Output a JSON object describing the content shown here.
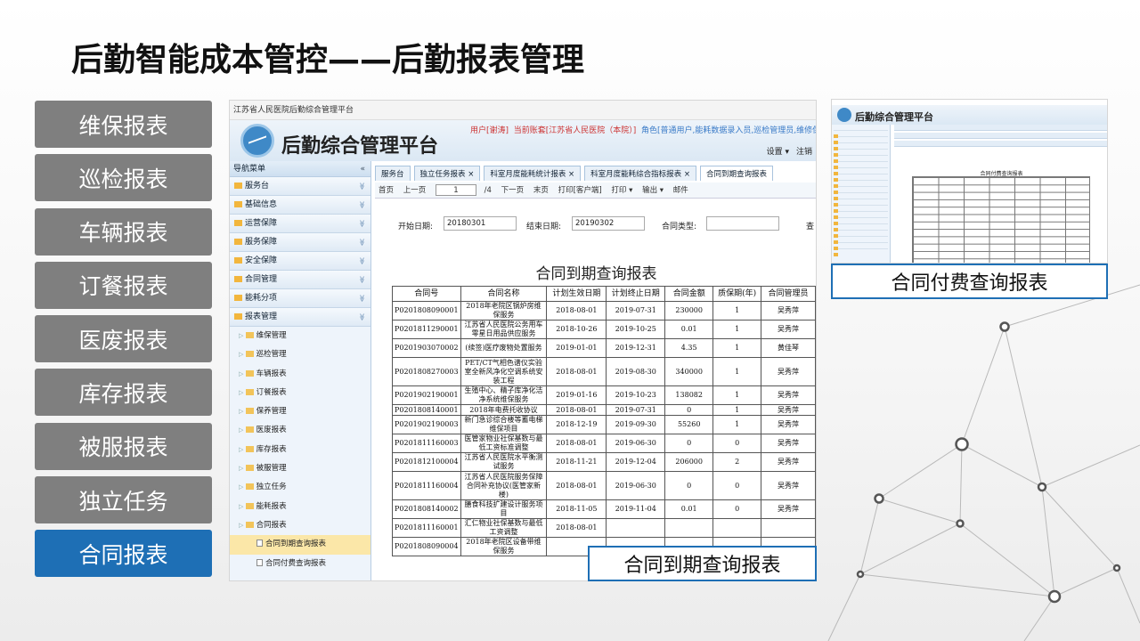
{
  "slide": {
    "title": "后勤智能成本管控——后勤报表管理",
    "menu": [
      "维保报表",
      "巡检报表",
      "车辆报表",
      "订餐报表",
      "医废报表",
      "库存报表",
      "被服报表",
      "独立任务",
      "合同报表"
    ],
    "active_index": 8,
    "caption_main": "合同到期查询报表",
    "caption_small": "合同付费查询报表",
    "colors": {
      "active": "#1e6fb5",
      "menu_bg": "#7f7f7f"
    }
  },
  "app": {
    "top_bar": "江苏省人民医院后勤综合管理平台",
    "app_title": "后勤综合管理平台",
    "user_line_a": "用户[谢涛]",
    "user_line_b": "当前账套[江苏省人民医院（本院）]",
    "user_line_c": "角色[普通用户,能耗数据录入员,巡检管理员,维修保障",
    "settings": "设置 ▾",
    "logout": "注销",
    "nav_header": "导航菜单",
    "nav": [
      "服务台",
      "基础信息",
      "运营保障",
      "服务保障",
      "安全保障",
      "合同管理",
      "能耗分项",
      "报表管理"
    ],
    "sub": [
      "维保管理",
      "巡检管理",
      "车辆报表",
      "订餐报表",
      "保养管理",
      "医废报表",
      "库存报表",
      "被服管理",
      "独立任务",
      "能耗报表",
      "合同报表"
    ],
    "leaf": [
      "合同到期查询报表",
      "合同付费查询报表"
    ],
    "tabs": [
      "服务台",
      "独立任务报表 ×",
      "科室月度能耗统计报表 ×",
      "科室月度能耗综合指标报表 ×",
      "合同到期查询报表"
    ],
    "toolbar": {
      "first": "首页",
      "prev": "上一页",
      "page": "1",
      "total": "/4",
      "next": "下一页",
      "last": "末页",
      "print_client": "打印[客户端]",
      "print": "打印 ▾",
      "export": "输出 ▾",
      "mail": "邮件"
    },
    "filter": {
      "start_label": "开始日期:",
      "start_value": "20180301",
      "end_label": "结束日期:",
      "end_value": "20190302",
      "type_label": "合同类型:",
      "query": "查"
    },
    "report_title": "合同到期查询报表",
    "columns": [
      "合同号",
      "合同名称",
      "计划生效日期",
      "计划终止日期",
      "合同金额",
      "质保期(年)",
      "合同管理员"
    ],
    "rows": [
      [
        "P0201808090001",
        "2018年老院区锅炉房维保服务",
        "2018-08-01",
        "2019-07-31",
        "230000",
        "1",
        "吴秀萍"
      ],
      [
        "P0201811290001",
        "江苏省人民医院公务用车零星日用品供应服务",
        "2018-10-26",
        "2019-10-25",
        "0.01",
        "1",
        "吴秀萍"
      ],
      [
        "P0201903070002",
        "(续签)医疗废物处置服务",
        "2019-01-01",
        "2019-12-31",
        "4.35",
        "1",
        "黄佳琴"
      ],
      [
        "P0201808270003",
        "PET/CT气相色谱仪实验室全新风净化空调系统安装工程",
        "2018-08-01",
        "2019-08-30",
        "340000",
        "1",
        "吴秀萍"
      ],
      [
        "P0201902190001",
        "生殖中心、精子库净化洁净系统维保服务",
        "2019-01-16",
        "2019-10-23",
        "138082",
        "1",
        "吴秀萍"
      ],
      [
        "P0201808140001",
        "2018年电费托收协议",
        "2018-08-01",
        "2019-07-31",
        "0",
        "1",
        "吴秀萍"
      ],
      [
        "P0201902190003",
        "新门急诊综合楼等蓄电梯维保项目",
        "2018-12-19",
        "2019-09-30",
        "55260",
        "1",
        "吴秀萍"
      ],
      [
        "P0201811160003",
        "医管家物业社保基数与最低工资标准调整",
        "2018-08-01",
        "2019-06-30",
        "0",
        "0",
        "吴秀萍"
      ],
      [
        "P0201812100004",
        "江苏省人民医院水平衡测试服务",
        "2018-11-21",
        "2019-12-04",
        "206000",
        "2",
        "吴秀萍"
      ],
      [
        "P0201811160004",
        "江苏省人民医院服务保障合同补充协议(医管家新楼)",
        "2018-08-01",
        "2019-06-30",
        "0",
        "0",
        "吴秀萍"
      ],
      [
        "P0201808140002",
        "膳食科技扩建设计服务项目",
        "2018-11-05",
        "2019-11-04",
        "0.01",
        "0",
        "吴秀萍"
      ],
      [
        "P0201811160001",
        "汇仁物业社保基数与最低工资调整",
        "2018-08-01",
        "",
        "",
        "",
        ""
      ],
      [
        "P0201808090004",
        "2018年老院区设备带维保服务",
        "",
        "",
        "",
        "",
        ""
      ]
    ]
  },
  "app2": {
    "app_title": "后勤综合管理平台",
    "report_title": "合同付费查询报表"
  }
}
